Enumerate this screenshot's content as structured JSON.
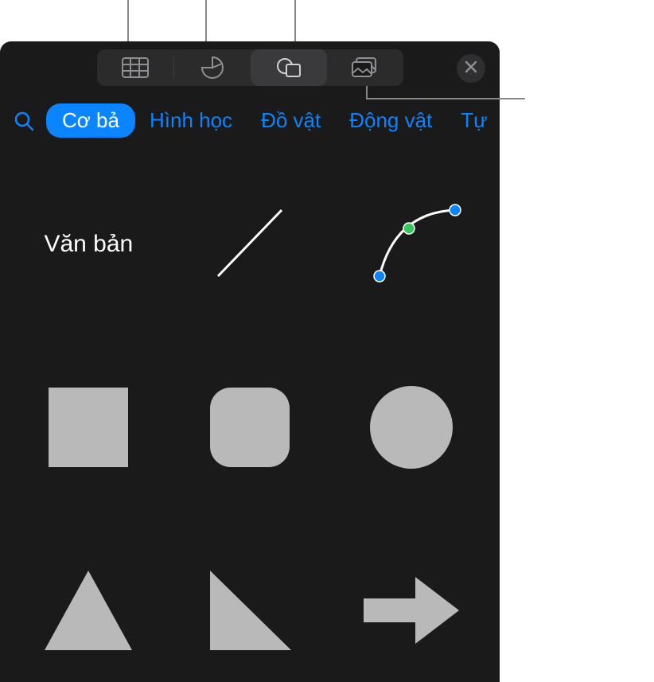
{
  "toolbar": {
    "segments": [
      {
        "name": "table-icon"
      },
      {
        "name": "chart-icon"
      },
      {
        "name": "shapes-icon"
      },
      {
        "name": "image-icon"
      }
    ],
    "close_label": "✕"
  },
  "tabs": {
    "items": [
      {
        "label": "Cơ bả",
        "active": true
      },
      {
        "label": "Hình học",
        "active": false
      },
      {
        "label": "Đồ vật",
        "active": false
      },
      {
        "label": "Động vật",
        "active": false
      },
      {
        "label": "Tự",
        "active": false
      }
    ]
  },
  "shapes": {
    "text_label": "Văn bản",
    "items": [
      {
        "name": "text-shape"
      },
      {
        "name": "line-shape"
      },
      {
        "name": "curve-shape"
      },
      {
        "name": "square-shape"
      },
      {
        "name": "rounded-square-shape"
      },
      {
        "name": "circle-shape"
      },
      {
        "name": "triangle-shape"
      },
      {
        "name": "right-triangle-shape"
      },
      {
        "name": "arrow-shape"
      }
    ]
  },
  "colors": {
    "accent": "#0a84ff",
    "shape_fill": "#b9b9b9",
    "background": "#1a1a1a"
  }
}
